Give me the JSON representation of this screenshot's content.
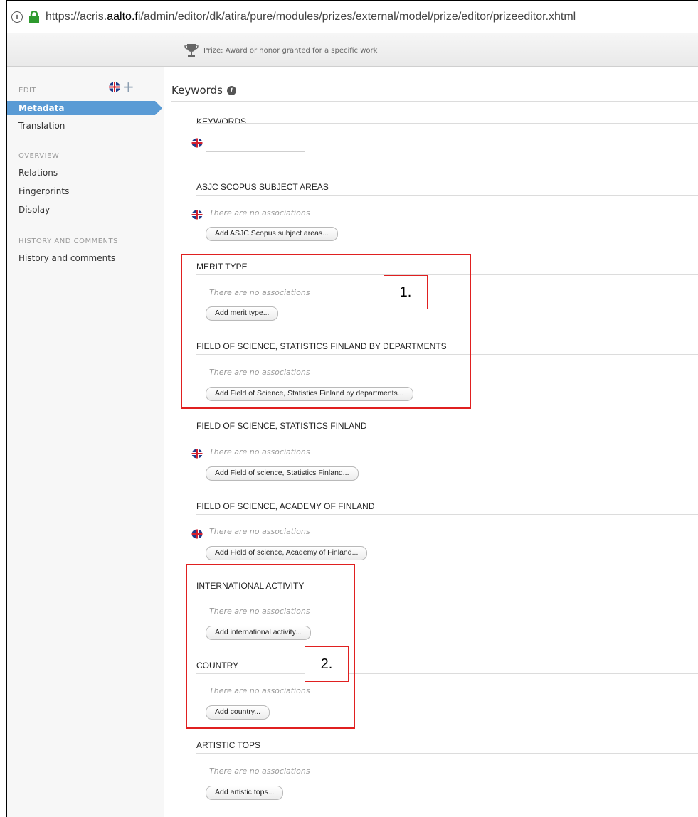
{
  "browser": {
    "url_scheme": "https://acris.",
    "url_host": "aalto.fi",
    "url_path": "/admin/editor/dk/atira/pure/modules/prizes/external/model/prize/editor/prizeeditor.xhtml"
  },
  "header": {
    "subtitle": "Prize: Award or honor granted for a specific work"
  },
  "sidebar": {
    "edit_label": "EDIT",
    "edit_items": [
      "Metadata",
      "Translation"
    ],
    "overview_label": "OVERVIEW",
    "overview_items": [
      "Relations",
      "Fingerprints",
      "Display"
    ],
    "history_label": "HISTORY AND COMMENTS",
    "history_items": [
      "History and comments"
    ]
  },
  "main": {
    "title": "Keywords",
    "no_assoc": "There are no associations",
    "sections": [
      {
        "heading": "KEYWORDS"
      },
      {
        "heading": "ASJC SCOPUS SUBJECT AREAS",
        "button": "Add ASJC Scopus subject areas..."
      },
      {
        "heading": "MERIT TYPE",
        "button": "Add merit type..."
      },
      {
        "heading": "FIELD OF SCIENCE, STATISTICS FINLAND BY DEPARTMENTS",
        "button": "Add Field of Science, Statistics Finland by departments..."
      },
      {
        "heading": "FIELD OF SCIENCE, STATISTICS FINLAND",
        "button": "Add Field of science, Statistics Finland..."
      },
      {
        "heading": "FIELD OF SCIENCE, ACADEMY OF FINLAND",
        "button": "Add Field of science, Academy of Finland..."
      },
      {
        "heading": "INTERNATIONAL ACTIVITY",
        "button": "Add international activity..."
      },
      {
        "heading": "COUNTRY",
        "button": "Add country..."
      },
      {
        "heading": "ARTISTIC TOPS",
        "button": "Add artistic tops..."
      }
    ]
  },
  "annotations": {
    "label_1": "1.",
    "label_2": "2."
  },
  "colors": {
    "accent": "#5a9bd5",
    "highlight_red": "#e02020",
    "lock_green": "#2e9a2e"
  }
}
